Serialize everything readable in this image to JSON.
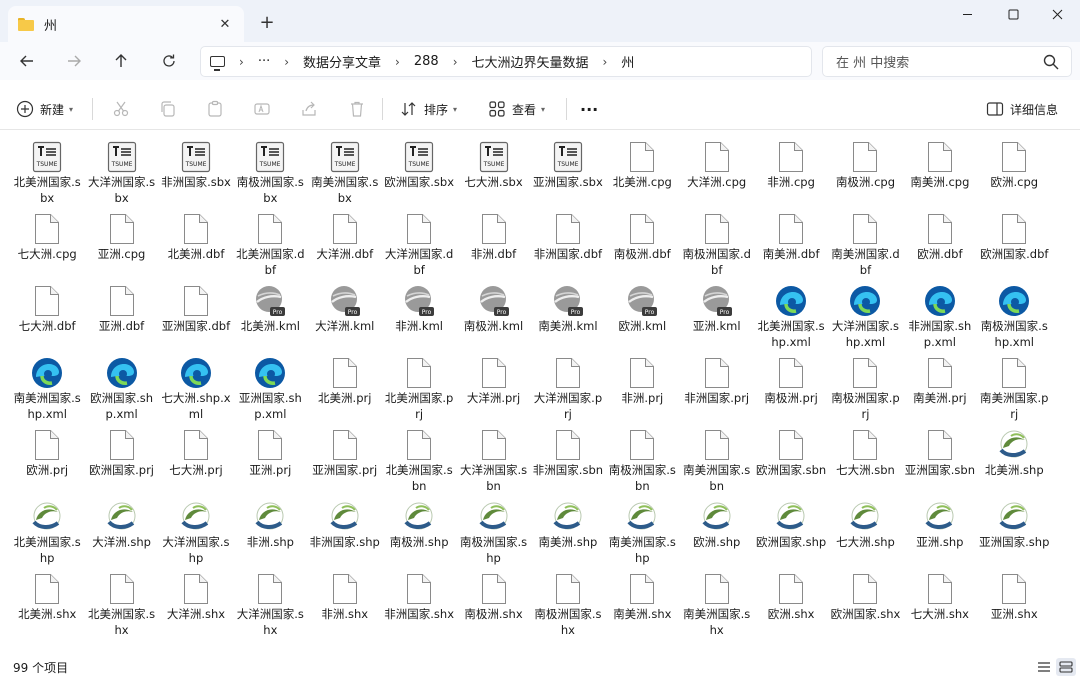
{
  "window": {
    "tab_title": "州",
    "minimize_glyph": "—",
    "maximize_glyph": "☐",
    "close_glyph": "✕"
  },
  "address": {
    "breadcrumbs": [
      "数据分享文章",
      "288",
      "七大洲边界矢量数据",
      "州"
    ],
    "ellipsis": "···"
  },
  "search": {
    "placeholder": "在 州 中搜索"
  },
  "toolbar": {
    "new_label": "新建",
    "sort_label": "排序",
    "view_label": "查看",
    "more_label": "···",
    "details_label": "详细信息"
  },
  "files": [
    {
      "name": "北美洲国家.sbx",
      "icon": "tsume-icon"
    },
    {
      "name": "大洋洲国家.sbx",
      "icon": "tsume-icon"
    },
    {
      "name": "非洲国家.sbx",
      "icon": "tsume-icon"
    },
    {
      "name": "南极洲国家.sbx",
      "icon": "tsume-icon"
    },
    {
      "name": "南美洲国家.sbx",
      "icon": "tsume-icon"
    },
    {
      "name": "欧洲国家.sbx",
      "icon": "tsume-icon"
    },
    {
      "name": "七大洲.sbx",
      "icon": "tsume-icon"
    },
    {
      "name": "亚洲国家.sbx",
      "icon": "tsume-icon"
    },
    {
      "name": "北美洲.cpg",
      "icon": "file-icon"
    },
    {
      "name": "大洋洲.cpg",
      "icon": "file-icon"
    },
    {
      "name": "非洲.cpg",
      "icon": "file-icon"
    },
    {
      "name": "南极洲.cpg",
      "icon": "file-icon"
    },
    {
      "name": "南美洲.cpg",
      "icon": "file-icon"
    },
    {
      "name": "欧洲.cpg",
      "icon": "file-icon"
    },
    {
      "name": "七大洲.cpg",
      "icon": "file-icon"
    },
    {
      "name": "亚洲.cpg",
      "icon": "file-icon"
    },
    {
      "name": "北美洲.dbf",
      "icon": "file-icon"
    },
    {
      "name": "北美洲国家.dbf",
      "icon": "file-icon"
    },
    {
      "name": "大洋洲.dbf",
      "icon": "file-icon"
    },
    {
      "name": "大洋洲国家.dbf",
      "icon": "file-icon"
    },
    {
      "name": "非洲.dbf",
      "icon": "file-icon"
    },
    {
      "name": "非洲国家.dbf",
      "icon": "file-icon"
    },
    {
      "name": "南极洲.dbf",
      "icon": "file-icon"
    },
    {
      "name": "南极洲国家.dbf",
      "icon": "file-icon"
    },
    {
      "name": "南美洲.dbf",
      "icon": "file-icon"
    },
    {
      "name": "南美洲国家.dbf",
      "icon": "file-icon"
    },
    {
      "name": "欧洲.dbf",
      "icon": "file-icon"
    },
    {
      "name": "欧洲国家.dbf",
      "icon": "file-icon"
    },
    {
      "name": "七大洲.dbf",
      "icon": "file-icon"
    },
    {
      "name": "亚洲.dbf",
      "icon": "file-icon"
    },
    {
      "name": "亚洲国家.dbf",
      "icon": "file-icon"
    },
    {
      "name": "北美洲.kml",
      "icon": "google-earth-pro-icon"
    },
    {
      "name": "大洋洲.kml",
      "icon": "google-earth-pro-icon"
    },
    {
      "name": "非洲.kml",
      "icon": "google-earth-pro-icon"
    },
    {
      "name": "南极洲.kml",
      "icon": "google-earth-pro-icon"
    },
    {
      "name": "南美洲.kml",
      "icon": "google-earth-pro-icon"
    },
    {
      "name": "欧洲.kml",
      "icon": "google-earth-pro-icon"
    },
    {
      "name": "亚洲.kml",
      "icon": "google-earth-pro-icon"
    },
    {
      "name": "北美洲国家.shp.xml",
      "icon": "edge-icon"
    },
    {
      "name": "大洋洲国家.shp.xml",
      "icon": "edge-icon"
    },
    {
      "name": "非洲国家.shp.xml",
      "icon": "edge-icon"
    },
    {
      "name": "南极洲国家.shp.xml",
      "icon": "edge-icon"
    },
    {
      "name": "南美洲国家.shp.xml",
      "icon": "edge-icon"
    },
    {
      "name": "欧洲国家.shp.xml",
      "icon": "edge-icon"
    },
    {
      "name": "七大洲.shp.xml",
      "icon": "edge-icon"
    },
    {
      "name": "亚洲国家.shp.xml",
      "icon": "edge-icon"
    },
    {
      "name": "北美洲.prj",
      "icon": "file-icon"
    },
    {
      "name": "北美洲国家.prj",
      "icon": "file-icon"
    },
    {
      "name": "大洋洲.prj",
      "icon": "file-icon"
    },
    {
      "name": "大洋洲国家.prj",
      "icon": "file-icon"
    },
    {
      "name": "非洲.prj",
      "icon": "file-icon"
    },
    {
      "name": "非洲国家.prj",
      "icon": "file-icon"
    },
    {
      "name": "南极洲.prj",
      "icon": "file-icon"
    },
    {
      "name": "南极洲国家.prj",
      "icon": "file-icon"
    },
    {
      "name": "南美洲.prj",
      "icon": "file-icon"
    },
    {
      "name": "南美洲国家.prj",
      "icon": "file-icon"
    },
    {
      "name": "欧洲.prj",
      "icon": "file-icon"
    },
    {
      "name": "欧洲国家.prj",
      "icon": "file-icon"
    },
    {
      "name": "七大洲.prj",
      "icon": "file-icon"
    },
    {
      "name": "亚洲.prj",
      "icon": "file-icon"
    },
    {
      "name": "亚洲国家.prj",
      "icon": "file-icon"
    },
    {
      "name": "北美洲国家.sbn",
      "icon": "file-icon"
    },
    {
      "name": "大洋洲国家.sbn",
      "icon": "file-icon"
    },
    {
      "name": "非洲国家.sbn",
      "icon": "file-icon"
    },
    {
      "name": "南极洲国家.sbn",
      "icon": "file-icon"
    },
    {
      "name": "南美洲国家.sbn",
      "icon": "file-icon"
    },
    {
      "name": "欧洲国家.sbn",
      "icon": "file-icon"
    },
    {
      "name": "七大洲.sbn",
      "icon": "file-icon"
    },
    {
      "name": "亚洲国家.sbn",
      "icon": "file-icon"
    },
    {
      "name": "北美洲.shp",
      "icon": "arcgis-shp-icon"
    },
    {
      "name": "北美洲国家.shp",
      "icon": "arcgis-shp-icon"
    },
    {
      "name": "大洋洲.shp",
      "icon": "arcgis-shp-icon"
    },
    {
      "name": "大洋洲国家.shp",
      "icon": "arcgis-shp-icon"
    },
    {
      "name": "非洲.shp",
      "icon": "arcgis-shp-icon"
    },
    {
      "name": "非洲国家.shp",
      "icon": "arcgis-shp-icon"
    },
    {
      "name": "南极洲.shp",
      "icon": "arcgis-shp-icon"
    },
    {
      "name": "南极洲国家.shp",
      "icon": "arcgis-shp-icon"
    },
    {
      "name": "南美洲.shp",
      "icon": "arcgis-shp-icon"
    },
    {
      "name": "南美洲国家.shp",
      "icon": "arcgis-shp-icon"
    },
    {
      "name": "欧洲.shp",
      "icon": "arcgis-shp-icon"
    },
    {
      "name": "欧洲国家.shp",
      "icon": "arcgis-shp-icon"
    },
    {
      "name": "七大洲.shp",
      "icon": "arcgis-shp-icon"
    },
    {
      "name": "亚洲.shp",
      "icon": "arcgis-shp-icon"
    },
    {
      "name": "亚洲国家.shp",
      "icon": "arcgis-shp-icon"
    },
    {
      "name": "北美洲.shx",
      "icon": "file-icon"
    },
    {
      "name": "北美洲国家.shx",
      "icon": "file-icon"
    },
    {
      "name": "大洋洲.shx",
      "icon": "file-icon"
    },
    {
      "name": "大洋洲国家.shx",
      "icon": "file-icon"
    },
    {
      "name": "非洲.shx",
      "icon": "file-icon"
    },
    {
      "name": "非洲国家.shx",
      "icon": "file-icon"
    },
    {
      "name": "南极洲.shx",
      "icon": "file-icon"
    },
    {
      "name": "南极洲国家.shx",
      "icon": "file-icon"
    },
    {
      "name": "南美洲.shx",
      "icon": "file-icon"
    },
    {
      "name": "南美洲国家.shx",
      "icon": "file-icon"
    },
    {
      "name": "欧洲.shx",
      "icon": "file-icon"
    },
    {
      "name": "欧洲国家.shx",
      "icon": "file-icon"
    },
    {
      "name": "七大洲.shx",
      "icon": "file-icon"
    },
    {
      "name": "亚洲.shx",
      "icon": "file-icon"
    }
  ],
  "status": {
    "item_count": "99 个项目"
  },
  "colors": {
    "accent": "#0067c0",
    "folder": "#f7c948",
    "titlebar": "#eef2f9"
  }
}
